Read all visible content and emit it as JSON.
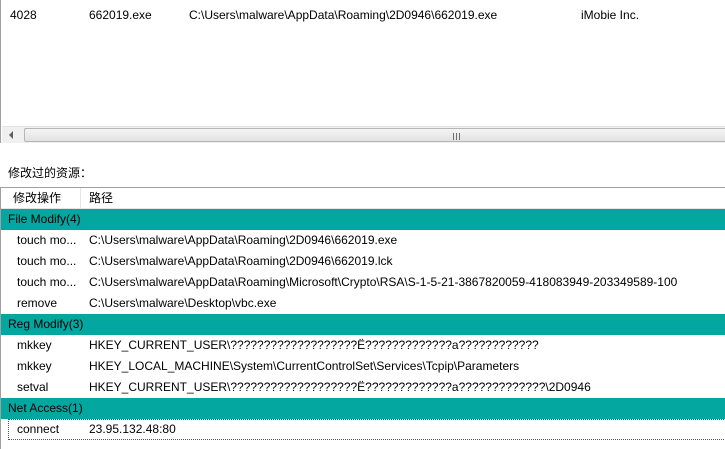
{
  "processes": [
    {
      "pid": "4028",
      "name": "662019.exe",
      "path": "C:\\Users\\malware\\AppData\\Roaming\\2D0946\\662019.exe",
      "company": "iMobie Inc."
    }
  ],
  "section_label": "修改过的资源：",
  "columns": {
    "operation": "修改操作",
    "path": "路径"
  },
  "groups": {
    "file": {
      "title": "File Modify(4)",
      "items": [
        {
          "op": "touch mo...",
          "path": "C:\\Users\\malware\\AppData\\Roaming\\2D0946\\662019.exe"
        },
        {
          "op": "touch mo...",
          "path": "C:\\Users\\malware\\AppData\\Roaming\\2D0946\\662019.lck"
        },
        {
          "op": "touch mo...",
          "path": "C:\\Users\\malware\\AppData\\Roaming\\Microsoft\\Crypto\\RSA\\S-1-5-21-3867820059-418083949-203349589-100"
        },
        {
          "op": "remove",
          "path": "C:\\Users\\malware\\Desktop\\vbc.exe"
        }
      ]
    },
    "reg": {
      "title": "Reg Modify(3)",
      "items": [
        {
          "op": "mkkey",
          "path": "HKEY_CURRENT_USER\\???????????????????Ё?????????????a????????????"
        },
        {
          "op": "mkkey",
          "path": "HKEY_LOCAL_MACHINE\\System\\CurrentControlSet\\Services\\Tcpip\\Parameters"
        },
        {
          "op": "setval",
          "path": "HKEY_CURRENT_USER\\???????????????????Ё?????????????a?????????????\\2D0946"
        }
      ]
    },
    "net": {
      "title": "Net Access(1)",
      "items": [
        {
          "op": "connect",
          "path": "23.95.132.48:80"
        }
      ]
    }
  },
  "colors": {
    "group_header_bg": "#04a6a0",
    "border": "#a0a0a0"
  }
}
